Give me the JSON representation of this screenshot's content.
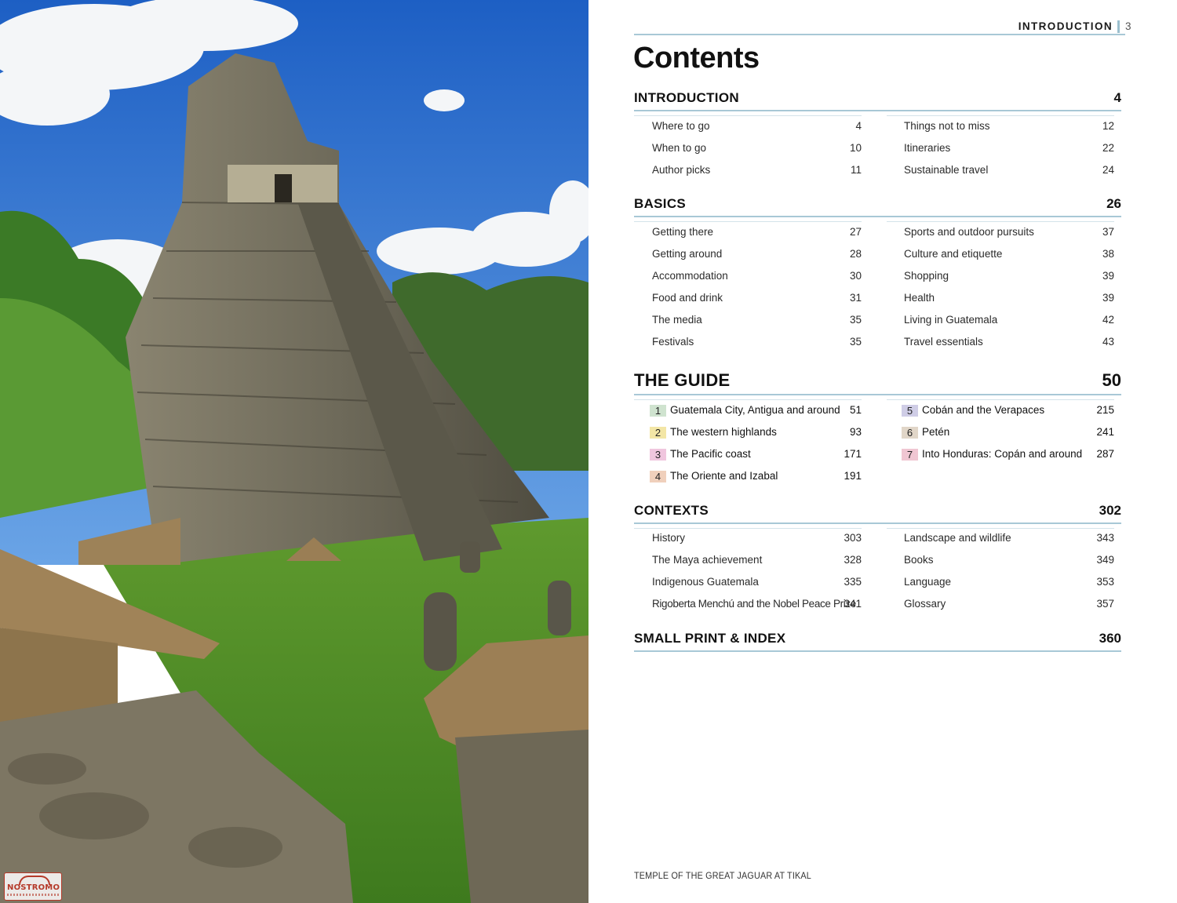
{
  "photo": {
    "subject": "stepped stone pyramid temple with thatched shelters on green lawn",
    "watermark": "NOSTROMO"
  },
  "running_head": {
    "section": "INTRODUCTION",
    "page": "3"
  },
  "title": "Contents",
  "introduction": {
    "title": "INTRODUCTION",
    "page": "4",
    "left": [
      {
        "label": "Where to go",
        "page": "4"
      },
      {
        "label": "When to go",
        "page": "10"
      },
      {
        "label": "Author picks",
        "page": "11"
      }
    ],
    "right": [
      {
        "label": "Things not to miss",
        "page": "12"
      },
      {
        "label": "Itineraries",
        "page": "22"
      },
      {
        "label": "Sustainable travel",
        "page": "24"
      }
    ]
  },
  "basics": {
    "title": "BASICS",
    "page": "26",
    "left": [
      {
        "label": "Getting there",
        "page": "27"
      },
      {
        "label": "Getting around",
        "page": "28"
      },
      {
        "label": "Accommodation",
        "page": "30"
      },
      {
        "label": "Food and drink",
        "page": "31"
      },
      {
        "label": "The media",
        "page": "35"
      },
      {
        "label": "Festivals",
        "page": "35"
      }
    ],
    "right": [
      {
        "label": "Sports and outdoor pursuits",
        "page": "37"
      },
      {
        "label": "Culture and etiquette",
        "page": "38"
      },
      {
        "label": "Shopping",
        "page": "39"
      },
      {
        "label": "Health",
        "page": "39"
      },
      {
        "label": "Living in Guatemala",
        "page": "42"
      },
      {
        "label": "Travel essentials",
        "page": "43"
      }
    ]
  },
  "guide": {
    "title": "THE GUIDE",
    "page": "50",
    "chapters": [
      {
        "num": "1",
        "label": "Guatemala City, Antigua and around",
        "page": "51",
        "color": "#cfe3cf"
      },
      {
        "num": "2",
        "label": "The western highlands",
        "page": "93",
        "color": "#f3e6a6"
      },
      {
        "num": "3",
        "label": "The Pacific coast",
        "page": "171",
        "color": "#f0c6de"
      },
      {
        "num": "4",
        "label": "The Oriente and Izabal",
        "page": "191",
        "color": "#f0d0bc"
      },
      {
        "num": "5",
        "label": "Cobán and the Verapaces",
        "page": "215",
        "color": "#cfcde6"
      },
      {
        "num": "6",
        "label": "Petén",
        "page": "241",
        "color": "#e1d6c8"
      },
      {
        "num": "7",
        "label": "Into Honduras: Copán and around",
        "page": "287",
        "color": "#f0c6d2"
      }
    ]
  },
  "contexts": {
    "title": "CONTEXTS",
    "page": "302",
    "left": [
      {
        "label": "History",
        "page": "303"
      },
      {
        "label": "The Maya achievement",
        "page": "328"
      },
      {
        "label": "Indigenous Guatemala",
        "page": "335"
      },
      {
        "label": "Rigoberta Menchú and the Nobel Peace Prize",
        "page": "341"
      }
    ],
    "right": [
      {
        "label": "Landscape and wildlife",
        "page": "343"
      },
      {
        "label": "Books",
        "page": "349"
      },
      {
        "label": "Language",
        "page": "353"
      },
      {
        "label": "Glossary",
        "page": "357"
      }
    ]
  },
  "small_print": {
    "title": "SMALL PRINT & INDEX",
    "page": "360"
  },
  "caption": "TEMPLE OF THE GREAT JAGUAR AT TIKAL"
}
